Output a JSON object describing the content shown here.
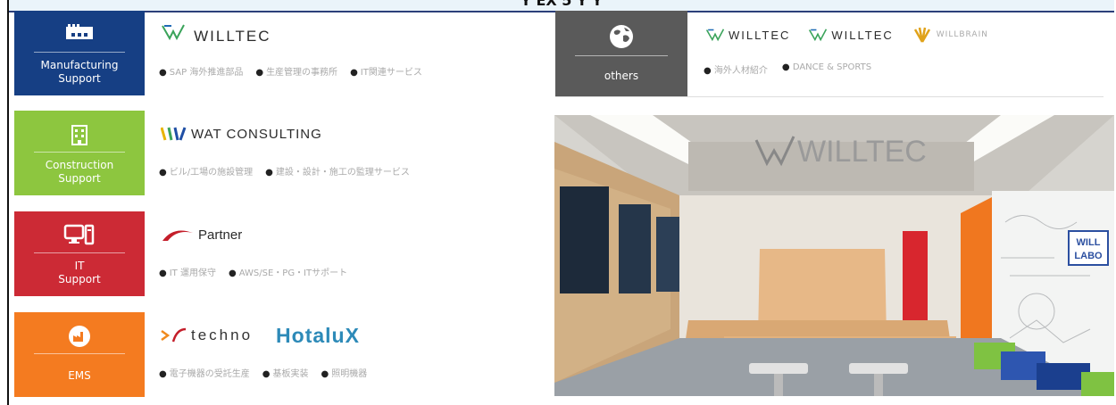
{
  "header": {
    "title": "Y EX 5 Y Y"
  },
  "rows": [
    {
      "tile": {
        "label": "Manufacturing\nSupport",
        "color": "#163f84",
        "icon": "factory-icon"
      },
      "logos": [
        {
          "text": "WILLTEC",
          "icon": "willtec-mark-icon"
        }
      ],
      "services": [
        "SAP 海外推進部品",
        "生産管理の事務所",
        "IT関連サービス"
      ]
    },
    {
      "tile": {
        "label": "Construction\nSupport",
        "color": "#8dc63f",
        "icon": "building-icon"
      },
      "logos": [
        {
          "text": "WAT CONSULTING",
          "icon": "wat-mark-icon"
        }
      ],
      "services": [
        "ビル/工場の施設管理",
        "建設・設計・施工の監理サービス"
      ]
    },
    {
      "tile": {
        "label": "IT\nSupport",
        "color": "#cc2a35",
        "icon": "computer-icon"
      },
      "logos": [
        {
          "text": "Partner",
          "icon": "partner-swoosh-icon"
        }
      ],
      "services": [
        "IT 運用保守",
        "AWS/SE・PG・ITサポート"
      ]
    },
    {
      "tile": {
        "label": "EMS",
        "color": "#f47b20",
        "icon": "factory-circle-icon"
      },
      "logos": [
        {
          "text": "techno",
          "icon": "techno-mark-icon"
        },
        {
          "text": "HotaluX",
          "icon": ""
        }
      ],
      "services": [
        "電子機器の受託生産",
        "基板実装",
        "照明機器"
      ]
    }
  ],
  "others": {
    "label": "others",
    "color": "#5a5a5a",
    "icon": "globe-icon",
    "logos": [
      "WILLTEC",
      "WILLTEC",
      "WILLBRAIN"
    ],
    "services": [
      "海外人材紹介",
      "DANCE & SPORTS"
    ]
  },
  "photo": {
    "sign_text": "WILLTEC",
    "labo_text": "WILL\nLABO",
    "accent_red": "#d8262e",
    "accent_orange": "#f0771f",
    "wood": "#e7b887"
  }
}
